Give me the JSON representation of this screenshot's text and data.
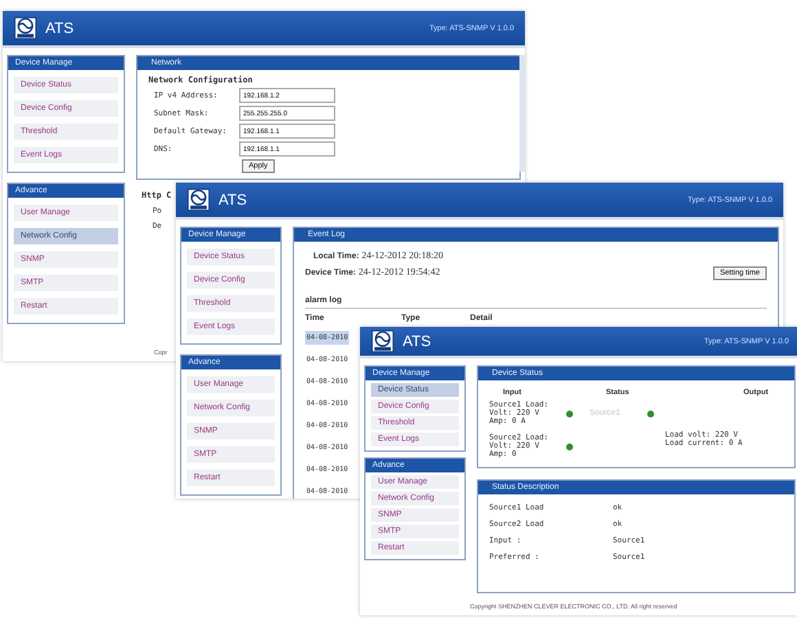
{
  "windows": [
    {
      "app_name": "ATS",
      "type_label": "Type: ATS-SNMP V 1.0.0",
      "sidebar": [
        {
          "title": "Device Manage",
          "items": [
            {
              "label": "Device Status",
              "selected": false
            },
            {
              "label": "Device Config",
              "selected": false
            },
            {
              "label": "Threshold",
              "selected": false
            },
            {
              "label": "Event Logs",
              "selected": false
            }
          ]
        },
        {
          "title": "Advance",
          "items": [
            {
              "label": "User Manage",
              "selected": false
            },
            {
              "label": "Network Config",
              "selected": true
            },
            {
              "label": "SNMP",
              "selected": false
            },
            {
              "label": "SMTP",
              "selected": false
            },
            {
              "label": "Restart",
              "selected": false
            }
          ]
        }
      ],
      "content": {
        "kind": "network",
        "panel_title": "Network",
        "heading": "Network Configuration",
        "fields": [
          {
            "label": "IP v4 Address:",
            "value": "192.168.1.2"
          },
          {
            "label": "Subnet Mask:",
            "value": "255.255.255.0"
          },
          {
            "label": "Default Gateway:",
            "value": "192.168.1.1"
          },
          {
            "label": "DNS:",
            "value": "192.168.1.1"
          }
        ],
        "apply_button": "Apply",
        "section_heading": "Http C",
        "section_lines": [
          "Po",
          "De"
        ]
      },
      "footer": "Copr"
    },
    {
      "app_name": "ATS",
      "type_label": "Type: ATS-SNMP V 1.0.0",
      "sidebar": [
        {
          "title": "Device Manage",
          "items": [
            {
              "label": "Device Status",
              "selected": false
            },
            {
              "label": "Device Config",
              "selected": false
            },
            {
              "label": "Threshold",
              "selected": false
            },
            {
              "label": "Event Logs",
              "selected": false
            }
          ]
        },
        {
          "title": "Advance",
          "items": [
            {
              "label": "User Manage",
              "selected": false
            },
            {
              "label": "Network Config",
              "selected": false
            },
            {
              "label": "SNMP",
              "selected": false
            },
            {
              "label": "SMTP",
              "selected": false
            },
            {
              "label": "Restart",
              "selected": false
            }
          ]
        }
      ],
      "content": {
        "kind": "event_log",
        "panel_title": "Event Log",
        "local_time_label": "Local Time:",
        "local_time": "24-12-2012 20:18:20",
        "device_time_label": "Device Time:",
        "device_time": "24-12-2012 19:54:42",
        "setting_button": "Setting time",
        "log_title": "alarm log",
        "columns": [
          "Time",
          "Type",
          "Detail"
        ],
        "rows": [
          {
            "time": "04-08-2010",
            "selected": true
          },
          {
            "time": "04-08-2010",
            "selected": false
          },
          {
            "time": "04-08-2010",
            "selected": false
          },
          {
            "time": "04-08-2010",
            "selected": false
          },
          {
            "time": "04-08-2010",
            "selected": false
          },
          {
            "time": "04-08-2010",
            "selected": false
          },
          {
            "time": "04-08-2010",
            "selected": false
          },
          {
            "time": "04-08-2010",
            "selected": false
          }
        ]
      }
    },
    {
      "app_name": "ATS",
      "type_label": "Type: ATS-SNMP V 1.0.0",
      "sidebar": [
        {
          "title": "Device Manage",
          "items": [
            {
              "label": "Device Status",
              "selected": true
            },
            {
              "label": "Device Config",
              "selected": false
            },
            {
              "label": "Threshold",
              "selected": false
            },
            {
              "label": "Event Logs",
              "selected": false
            }
          ]
        },
        {
          "title": "Advance",
          "items": [
            {
              "label": "User Manage",
              "selected": false
            },
            {
              "label": "Network Config",
              "selected": false
            },
            {
              "label": "SNMP",
              "selected": false
            },
            {
              "label": "SMTP",
              "selected": false
            },
            {
              "label": "Restart",
              "selected": false
            }
          ]
        }
      ],
      "content": {
        "kind": "device_status",
        "panel_title": "Device Status",
        "columns": [
          "Input",
          "Status",
          "Output"
        ],
        "sources": [
          {
            "name": "Source1 Load:",
            "volt": "Volt:  220 V",
            "amp": "Amp:  0 A",
            "on": true,
            "status_text": "Source1",
            "output_on": true
          },
          {
            "name": "Source2 Load:",
            "volt": "Volt:  220 V",
            "amp": "Amp:  0",
            "on": true
          }
        ],
        "output_lines": [
          "Load volt:   220 V",
          "Load current:  0 A"
        ],
        "description_title": "Status Description",
        "description": [
          {
            "label": "Source1  Load",
            "value": "ok"
          },
          {
            "label": "Source2  Load",
            "value": "ok"
          },
          {
            "label": "Input :",
            "value": "Source1"
          },
          {
            "label": "Preferred :",
            "value": "Source1"
          }
        ]
      },
      "footer": "Copyright SHENZHEN CLEVER ELECTRONIC CO., LTD. All right reserved"
    }
  ]
}
